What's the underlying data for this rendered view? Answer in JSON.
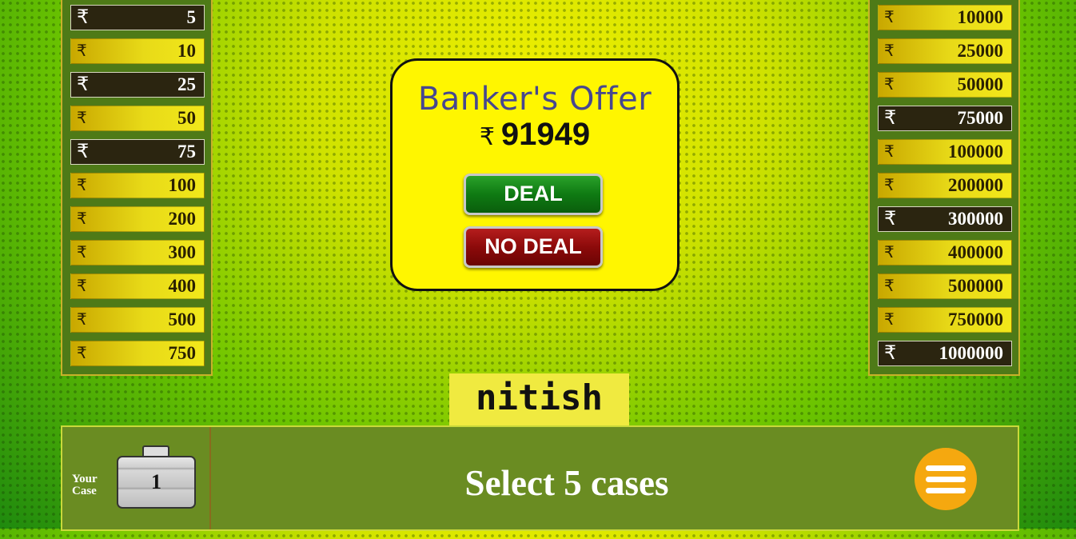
{
  "currency_symbol": "₹",
  "left_board": [
    {
      "amount": "5",
      "eliminated": true
    },
    {
      "amount": "10",
      "eliminated": false
    },
    {
      "amount": "25",
      "eliminated": true
    },
    {
      "amount": "50",
      "eliminated": false
    },
    {
      "amount": "75",
      "eliminated": true
    },
    {
      "amount": "100",
      "eliminated": false
    },
    {
      "amount": "200",
      "eliminated": false
    },
    {
      "amount": "300",
      "eliminated": false
    },
    {
      "amount": "400",
      "eliminated": false
    },
    {
      "amount": "500",
      "eliminated": false
    },
    {
      "amount": "750",
      "eliminated": false
    }
  ],
  "right_board": [
    {
      "amount": "10000",
      "eliminated": false
    },
    {
      "amount": "25000",
      "eliminated": false
    },
    {
      "amount": "50000",
      "eliminated": false
    },
    {
      "amount": "75000",
      "eliminated": true
    },
    {
      "amount": "100000",
      "eliminated": false
    },
    {
      "amount": "200000",
      "eliminated": false
    },
    {
      "amount": "300000",
      "eliminated": true
    },
    {
      "amount": "400000",
      "eliminated": false
    },
    {
      "amount": "500000",
      "eliminated": false
    },
    {
      "amount": "750000",
      "eliminated": false
    },
    {
      "amount": "1000000",
      "eliminated": true
    }
  ],
  "offer": {
    "title": "Banker's Offer",
    "amount": "91949",
    "deal_label": "DEAL",
    "no_deal_label": "NO DEAL"
  },
  "player_name": "nitish",
  "bottom": {
    "your_case_line1": "Your",
    "your_case_line2": "Case",
    "case_number": "1",
    "status": "Select 5 cases"
  },
  "colors": {
    "offer_bg": "#fff600",
    "deal_green": "#0f7a13",
    "no_deal_red": "#8c0a0a",
    "menu_orange": "#f5a80f",
    "bar_green": "#6a8c22"
  },
  "icons": {
    "menu": "hamburger-icon",
    "case": "briefcase-icon"
  }
}
